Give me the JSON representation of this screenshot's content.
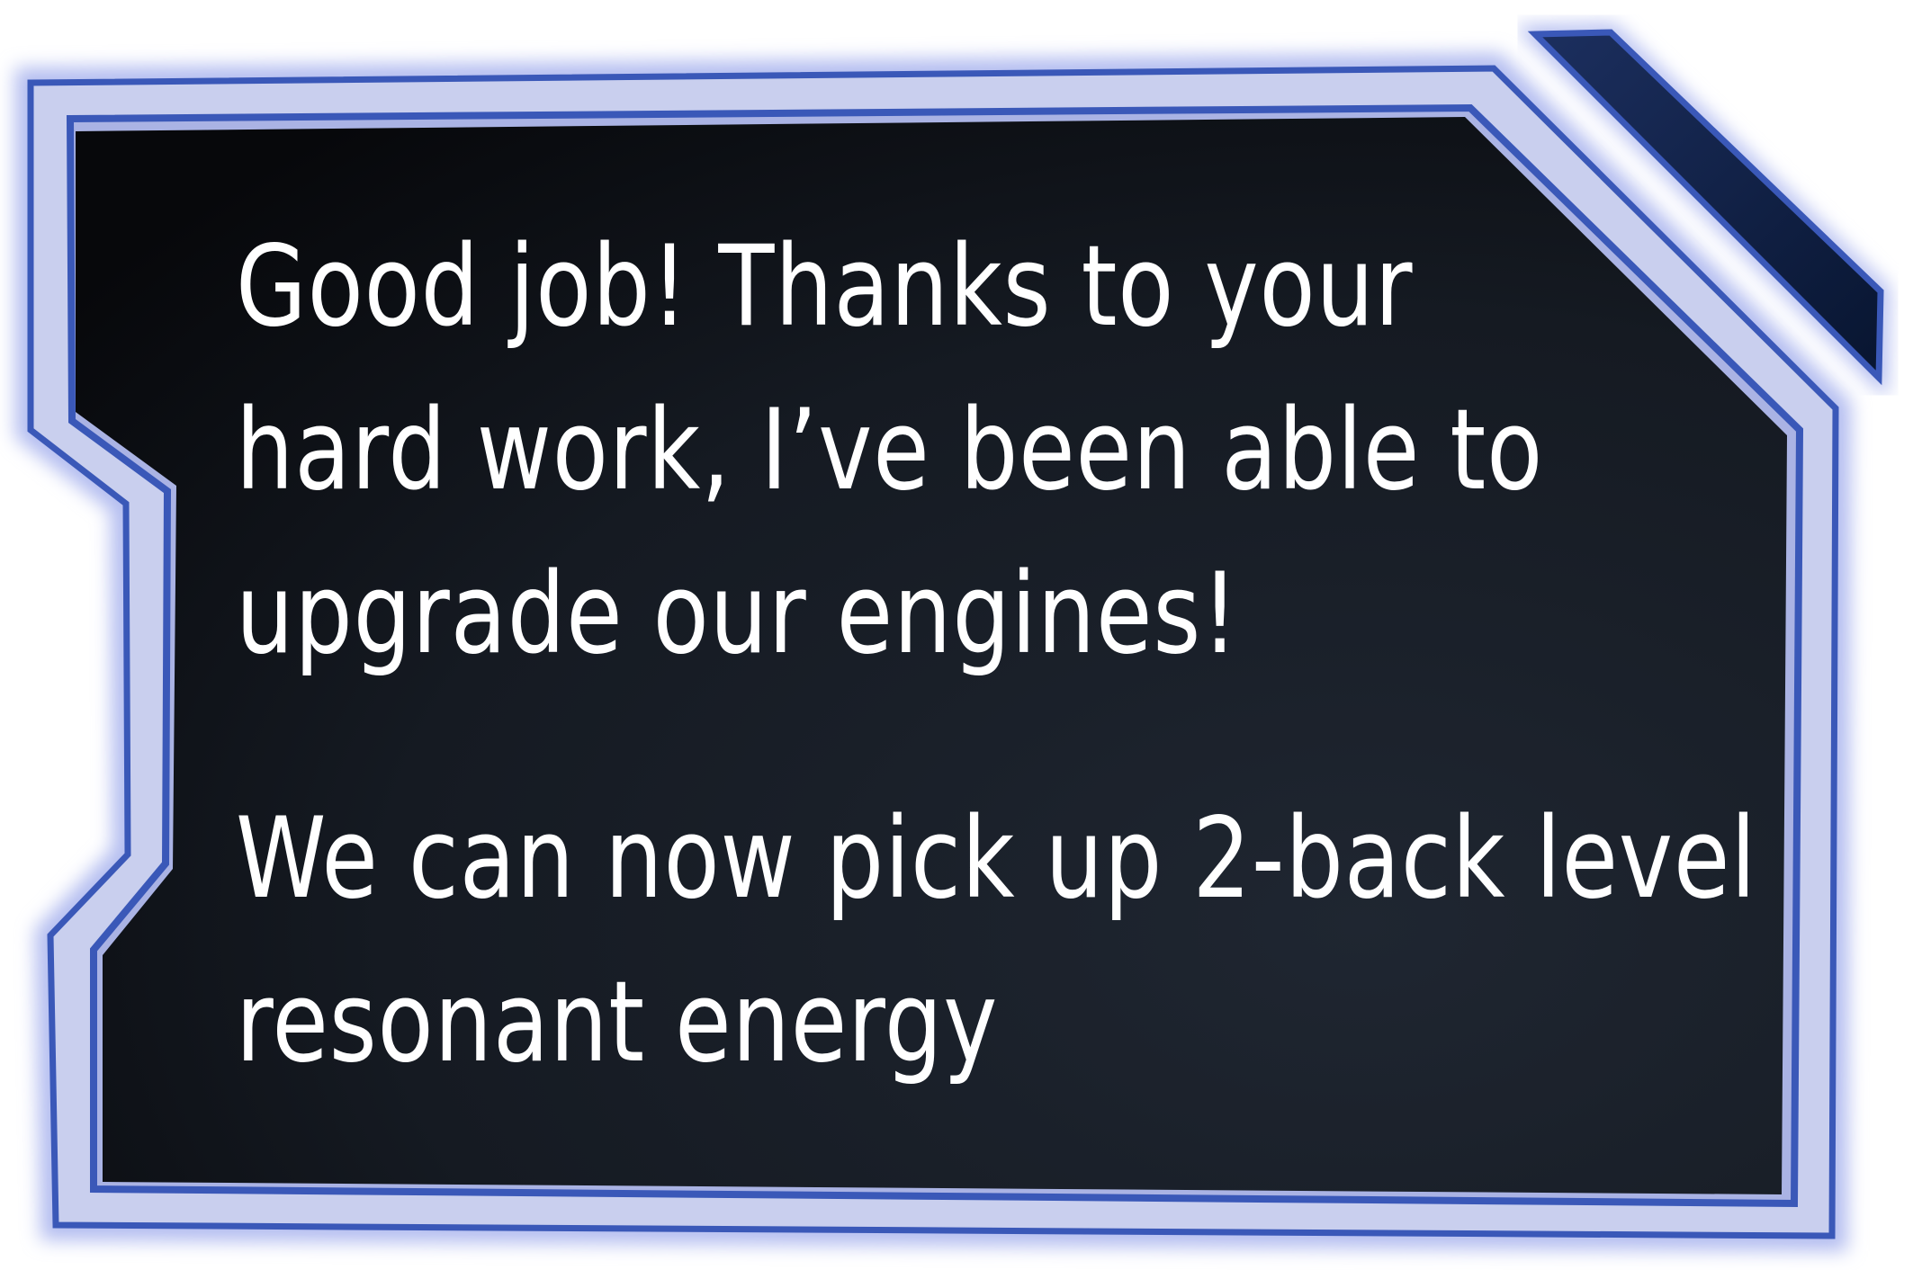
{
  "dialog": {
    "paragraphs": [
      {
        "lines": [
          "Good job! Thanks to your",
          "hard work, I’ve been able to",
          "upgrade our engines!"
        ]
      },
      {
        "lines": [
          "We can now pick up 2-back level",
          "resonant energy"
        ]
      }
    ]
  },
  "colors": {
    "panel_dark": "#0d0f14",
    "panel_light": "#1d2430",
    "border_blue": "#3a58b8",
    "glow_blue": "#9aa6e6",
    "accent_tab": "#0f1e44",
    "text": "#ffffff"
  }
}
